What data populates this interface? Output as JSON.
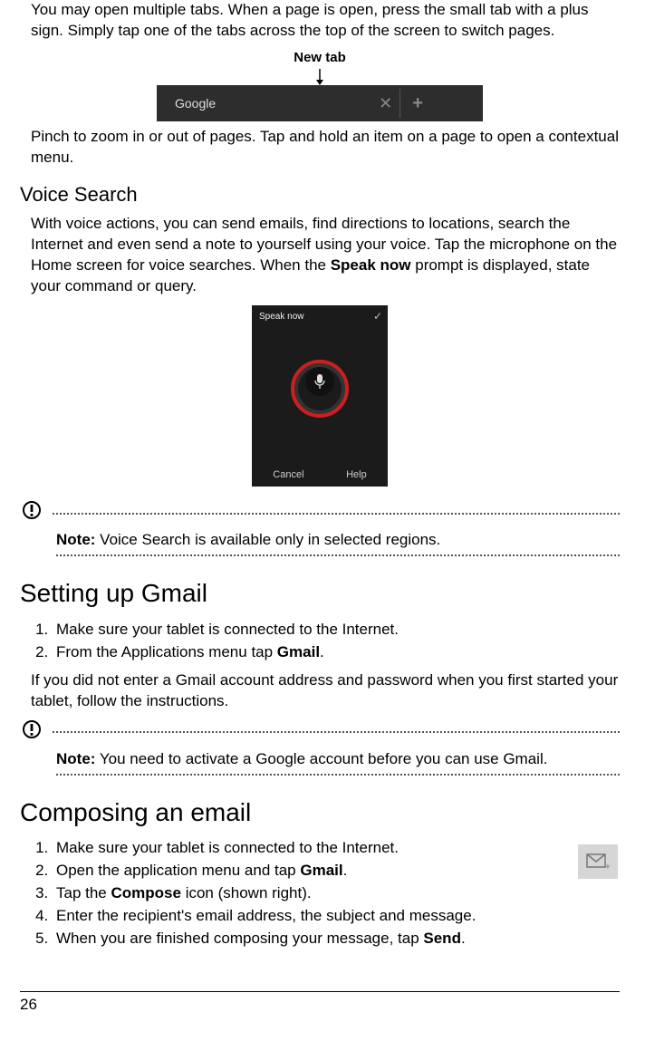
{
  "intro": {
    "p1": "You may open multiple tabs. When a page is open, press the small tab with a plus sign. Simply tap one of the tabs across the top of the screen to switch pages.",
    "newtab_label": "New tab",
    "tab_text": "Google",
    "p2": "Pinch to zoom in or out of pages. Tap and hold an item on a page to open a contextual menu."
  },
  "voice": {
    "heading": "Voice Search",
    "body_a": "With voice actions, you can send emails, find directions to locations, search the Internet and even send a note to yourself using your voice. Tap the microphone on the Home screen for voice searches. When the ",
    "speak_now": "Speak now",
    "body_b": " prompt is displayed, state your command or query.",
    "screen_title": "Speak now",
    "cancel": "Cancel",
    "help": "Help",
    "note_label": "Note:",
    "note_body": " Voice Search is available only in selected regions."
  },
  "gmail": {
    "heading": "Setting up Gmail",
    "steps": [
      "Make sure your tablet is connected to the Internet.",
      "From the Applications menu tap "
    ],
    "gmail_bold": "Gmail",
    "after_steps": "If you did not enter a Gmail account address and password when you first started your tablet, follow the instructions.",
    "note_label": "Note:",
    "note_body": " You need to activate a Google account before you can use Gmail."
  },
  "compose": {
    "heading": "Composing an email",
    "steps": {
      "s1": "Make sure your tablet is connected to the Internet.",
      "s2a": "Open the application menu and tap ",
      "s2b": "Gmail",
      "s3a": "Tap the ",
      "s3b": "Compose",
      "s3c": " icon (shown right).",
      "s4": "Enter the recipient's email address, the subject and message.",
      "s5a": "When you are finished composing your message, tap ",
      "s5b": "Send"
    }
  },
  "page_number": "26"
}
